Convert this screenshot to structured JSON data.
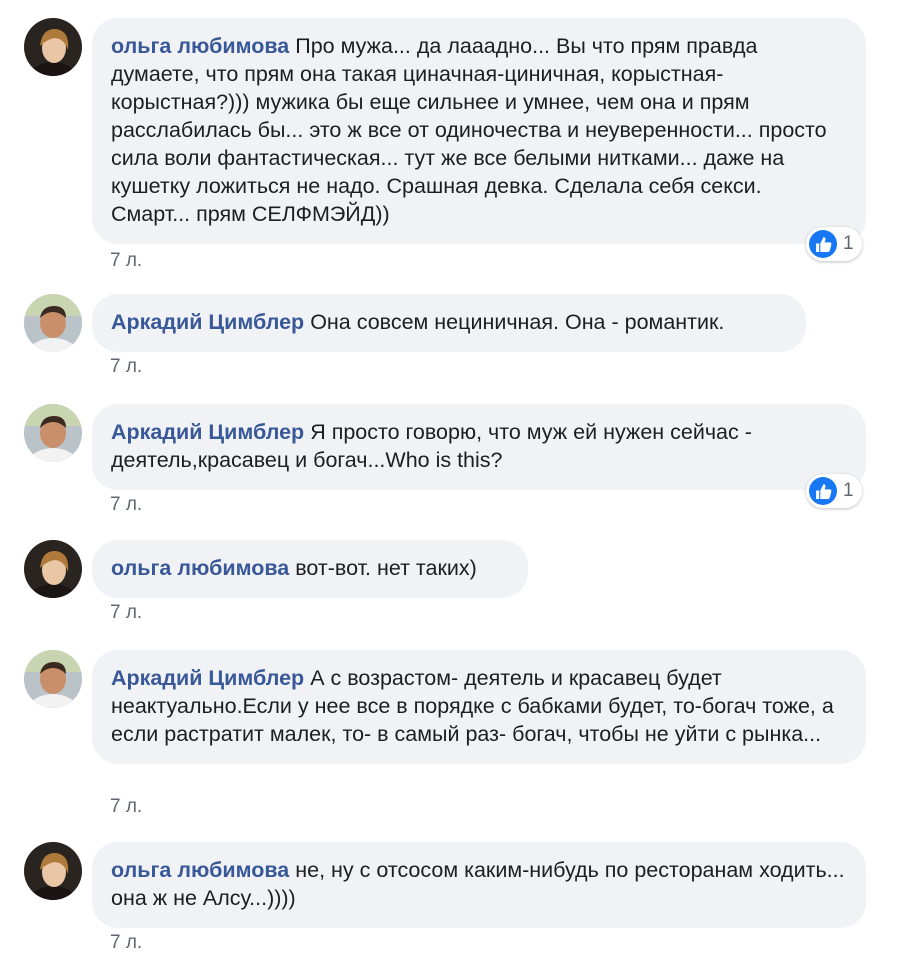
{
  "comments": [
    {
      "author": "ольга любимова",
      "text": "Про мужа... да лааадно... Вы что прям правда думаете, что прям она такая циначная-циничная, корыстная-корыстная?))) мужика бы еще сильнее и умнее, чем она и прям расслабилась бы... это ж все от одиночества и неуверенности... просто сила воли фантастическая... тут же все белыми нитками... даже на кушетку ложиться не надо. Срашная девка. Сделала себя секси. Смарт... прям СЕЛФМЭЙД))",
      "time": "7 л.",
      "reaction_count": "1"
    },
    {
      "author": "Аркадий Цимблер",
      "text": "Она совсем нециничная. Она - романтик.",
      "time": "7 л."
    },
    {
      "author": "Аркадий Цимблер",
      "text": "Я просто говорю, что муж ей нужен сейчас - деятель,красавец и богач...Who is this?",
      "time": "7 л.",
      "reaction_count": "1"
    },
    {
      "author": "ольга любимова",
      "text": "вот-вот. нет таких)",
      "time": "7 л."
    },
    {
      "author": "Аркадий Цимблер",
      "text": "А с возрастом- деятель и красавец будет неактуально.Если у нее все в порядке с бабками будет, то-богач тоже, а если растратит малек, то- в самый раз- богач, чтобы не уйти с рынка...",
      "time": "7 л."
    },
    {
      "author": "ольга любимова",
      "text": "не, ну с отсосом каким-нибудь по ресторанам ходить... она ж не Алсу...))))",
      "time": "7 л."
    }
  ],
  "icons": {
    "reaction": "like-icon",
    "avatar_olga": "avatar-olga",
    "avatar_arkady": "avatar-arkady"
  },
  "colors": {
    "author": "#385898",
    "bubble": "#f0f2f5",
    "like": "#1877f2"
  }
}
